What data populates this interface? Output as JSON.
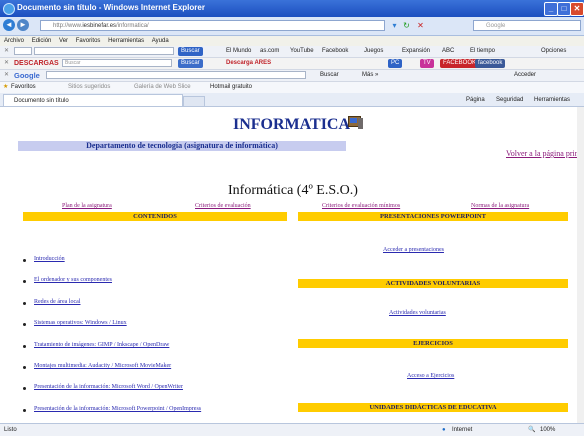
{
  "window": {
    "title": "Documento sin título - Windows Internet Explorer",
    "min": "_",
    "max": "□",
    "close": "✕"
  },
  "address": {
    "url_prefix": "http://www.",
    "url_domain": "iesbinefar.es",
    "url_path": "/informatica/",
    "search_placeholder": "Google"
  },
  "menu": [
    "Archivo",
    "Edición",
    "Ver",
    "Favoritos",
    "Herramientas",
    "Ayuda"
  ],
  "toolbar1": {
    "search_placeholder": "",
    "buscar": "Buscar",
    "links": [
      "El Mundo",
      "as.com",
      "YouTube",
      "Facebook",
      "Juegos",
      "Expansión",
      "ABC",
      "El tiempo"
    ],
    "opciones": "Opciones"
  },
  "toolbar2": {
    "brand": "DESCARGAS",
    "search_placeholder": "Buscar",
    "buscar": "Buscar",
    "descarga": "Descarga ARES",
    "badges": [
      "PC",
      "TV",
      "FACEBOOK",
      "facebook"
    ]
  },
  "toolbar3": {
    "brand": "Google",
    "buscar": "Buscar",
    "mas": "Más »",
    "acceder": "Acceder"
  },
  "favorites": {
    "label": "Favoritos",
    "items": [
      "Sitios sugeridos",
      "Galería de Web Slice",
      "Hotmail gratuito"
    ]
  },
  "tabs": {
    "active": "Documento sin título",
    "cmd": [
      "Página",
      "Seguridad",
      "Herramientas"
    ]
  },
  "page": {
    "title": "INFORMATICA",
    "department": "Departamento de tecnología (asignatura de informática)",
    "volver": "Volver a la página principal",
    "heading": "Informática (4º E.S.O.)",
    "top_links": [
      "Plan de la asignatura",
      "Criterios de evaluación",
      "Criterios de evaluación mínimos",
      "Normas de la asignatura"
    ],
    "left_header": "CONTENIDOS",
    "left_items": [
      "Introducción",
      "El ordenador y sus componentes",
      "Redes de área local",
      "Sistemas operativos: Windows / Linux",
      "Tratamiento de imágenes: GIMP / Inkscape / OpenDraw",
      "Montajes multimedia: Audacity / Microsoft MovieMaker",
      "Presentación de la información: Microsoft Word / OpenWriter",
      "Presentación de la información: Microsoft Powerpoint / OpenImpress"
    ],
    "right_sections": [
      {
        "header": "PRESENTACIONES POWERPOINT",
        "link": "Acceder a presentaciones"
      },
      {
        "header": "ACTIVIDADES VOLUNTARIAS",
        "link": "Actividades voluntarias"
      },
      {
        "header": "EJERCICIOS",
        "link": "Acceso a Ejercicios"
      },
      {
        "header": "UNIDADES DIDÁCTICAS DE EDUCATIVA",
        "link": ""
      }
    ]
  },
  "status": {
    "left": "Listo",
    "zone": "Internet",
    "zoom": "100%"
  }
}
